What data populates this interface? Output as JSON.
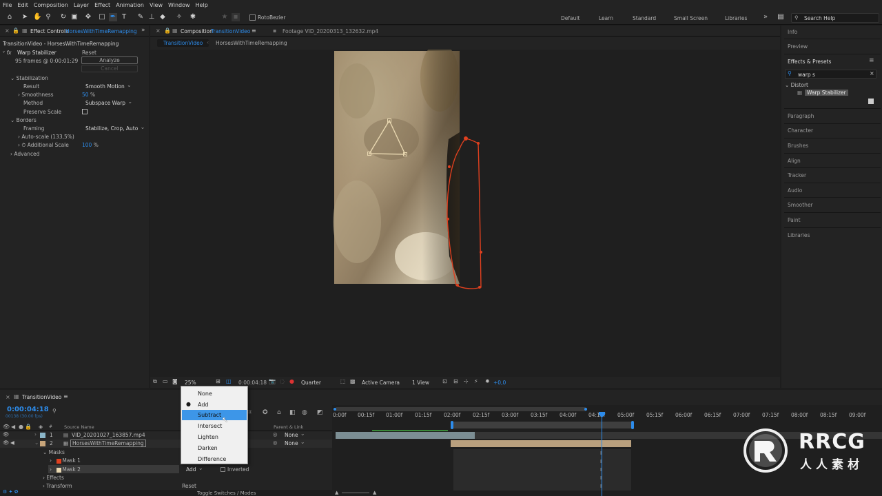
{
  "menubar": [
    "File",
    "Edit",
    "Composition",
    "Layer",
    "Effect",
    "Animation",
    "View",
    "Window",
    "Help"
  ],
  "toolbar": {
    "rotobezier": "RotoBezier",
    "workspaces": [
      "Default",
      "Learn",
      "Standard",
      "Small Screen",
      "Libraries"
    ],
    "overflow": "»",
    "search_placeholder": "Search Help"
  },
  "effect_controls": {
    "tab_label": "Effect Controls",
    "tab_layer": "HorsesWithTimeRemapping",
    "breadcrumb": "TransitionVideo - HorsesWithTimeRemapping",
    "effect_name": "Warp Stabilizer",
    "reset": "Reset",
    "frames": "95 frames @ 0:00:01:29",
    "analyze": "Analyze",
    "cancel": "Cancel",
    "stabilization": "Stabilization",
    "result_label": "Result",
    "result_value": "Smooth Motion",
    "smoothness_label": "Smoothness",
    "smoothness_value": "50",
    "smoothness_unit": "%",
    "method_label": "Method",
    "method_value": "Subspace Warp",
    "preserve_scale": "Preserve Scale",
    "borders": "Borders",
    "framing_label": "Framing",
    "framing_value": "Stabilize, Crop, Auto",
    "autoscale": "Auto-scale (133,5%)",
    "additional_scale_label": "Additional Scale",
    "additional_scale_value": "100",
    "additional_scale_unit": "%",
    "advanced": "Advanced"
  },
  "composition": {
    "tab_label": "Composition",
    "tab_name": "TransitionVideo",
    "footage_tab": "Footage  VID_20200313_132632.mp4",
    "subtabs": [
      "TransitionVideo",
      "HorsesWithTimeRemapping"
    ],
    "zoom": "25%",
    "timecode": "0:00:04:18",
    "resolution": "Quarter",
    "camera": "Active Camera",
    "views": "1 View",
    "exposure": "+0,0"
  },
  "right_panel": {
    "items_top": [
      "Info",
      "Preview",
      "Effects & Presets"
    ],
    "search_value": "warp s",
    "category": "Distort",
    "effect": "Warp Stabilizer",
    "items_bottom": [
      "Paragraph",
      "Character",
      "Brushes",
      "Align",
      "Tracker",
      "Audio",
      "Smoother",
      "Paint",
      "Libraries"
    ]
  },
  "timeline": {
    "tab_label": "TransitionVideo",
    "current_time": "0:00:04:18",
    "frame_info": "00138 (30.00 fps)",
    "column_source": "Source Name",
    "column_parent": "Parent & Link",
    "layers": [
      {
        "num": "1",
        "name": "VID_20201027_163857.mp4",
        "parent": "None"
      },
      {
        "num": "2",
        "name": "HorsesWithTimeRemapping",
        "parent": "None"
      }
    ],
    "masks_label": "Masks",
    "mask1": "Mask 1",
    "mask2": "Mask 2",
    "mask2_mode": "Add",
    "mask2_inverted": "Inverted",
    "effects": "Effects",
    "transform": "Transform",
    "transform_reset": "Reset",
    "toggle": "Toggle Switches / Modes",
    "ruler": [
      "0:00f",
      "00:15f",
      "01:00f",
      "01:15f",
      "02:00f",
      "02:15f",
      "03:00f",
      "03:15f",
      "04:00f",
      "04:15f",
      "05:00f",
      "05:15f",
      "06:00f",
      "06:15f",
      "07:00f",
      "07:15f",
      "08:00f",
      "08:15f",
      "09:00f"
    ]
  },
  "blend_menu": {
    "items": [
      "None",
      "Add",
      "Subtract",
      "Intersect",
      "Lighten",
      "Darken",
      "Difference"
    ],
    "checked": "Add",
    "highlighted": "Subtract"
  },
  "watermark": {
    "text1": "RRCG",
    "text2": "人人素材"
  },
  "colors": {
    "accent": "#2d8ceb",
    "mask_red": "#e0401f",
    "highlight": "#3d96e8",
    "bg": "#1d1d1d"
  }
}
